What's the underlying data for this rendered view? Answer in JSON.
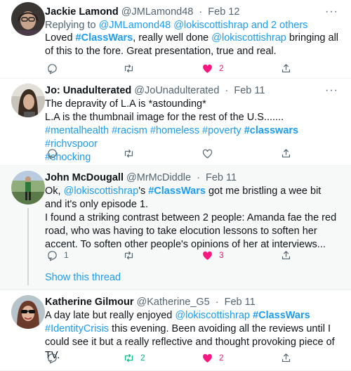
{
  "tweets": [
    {
      "name": "Jackie Lamond",
      "handle": "@JMLamond48",
      "time": "Feb 12",
      "reply_prefix": "Replying to ",
      "reply_user1": "@JMLamond48",
      "reply_user2": "@lokiscottishrap",
      "reply_rest": "and 2 others",
      "text": {
        "t1": "Loved ",
        "tag": "#ClassWars",
        "t2": ", really well done ",
        "mention": "@lokiscottishrap",
        "t3": " bringing all of this to the fore. Great presentation, true and real."
      },
      "reply_count": "",
      "retweet_count": "",
      "like_count": "2"
    },
    {
      "name": "Jo: Unadulterated",
      "handle": "@JoUnadulterated",
      "time": "Feb 11",
      "text": {
        "line1": "The depravity of L.A is *astounding*",
        "line2": "L.A is the thumbnail image for the rest of the U.S.......",
        "tags1": "#mentalhealth #racism #homeless #poverty ",
        "tag_bold": "#classwars",
        "tags2": " #richvspoor",
        "tags3": "#shocking"
      },
      "reply_count": "",
      "retweet_count": "",
      "like_count": ""
    },
    {
      "name": "John McDougall",
      "handle": "@MrMcDiddle",
      "time": "Feb 11",
      "text": {
        "t1": "Ok, ",
        "mention": "@lokiscottishrap",
        "t2": "'s ",
        "tag": "#ClassWars",
        "t3": " got me bristling a wee bit and it's only episode 1.",
        "para2": "I found a striking contrast between 2 people: Amanda fae the red road, who was having to take elocution lessons to soften her accent. To soften other people's opinions of her at interviews..."
      },
      "reply_count": "1",
      "retweet_count": "",
      "like_count": "3",
      "show_thread": "Show this thread"
    },
    {
      "name": "Katherine Gilmour",
      "handle": "@Katherine_G5",
      "time": "Feb 11",
      "text": {
        "t1": "A day late but really enjoyed ",
        "mention": "@lokiscottishrap",
        "t2": " ",
        "tag": "#ClassWars",
        "tag2": "#IdentityCrisis",
        "t3": " this evening. Been avoiding all the reviews until I could see it but a really reflective and thought provoking piece of TV."
      },
      "reply_count": "",
      "retweet_count": "2",
      "like_count": "2"
    }
  ],
  "icons": {
    "reply": "reply-icon",
    "retweet": "retweet-icon",
    "like": "heart-icon",
    "share": "share-icon",
    "more": "more-icon"
  },
  "colors": {
    "link": "#1d9bf0",
    "like": "#f91880",
    "retweet_active": "#00ba7c",
    "muted": "#536471",
    "thread_bg": "#f7f9f9"
  }
}
